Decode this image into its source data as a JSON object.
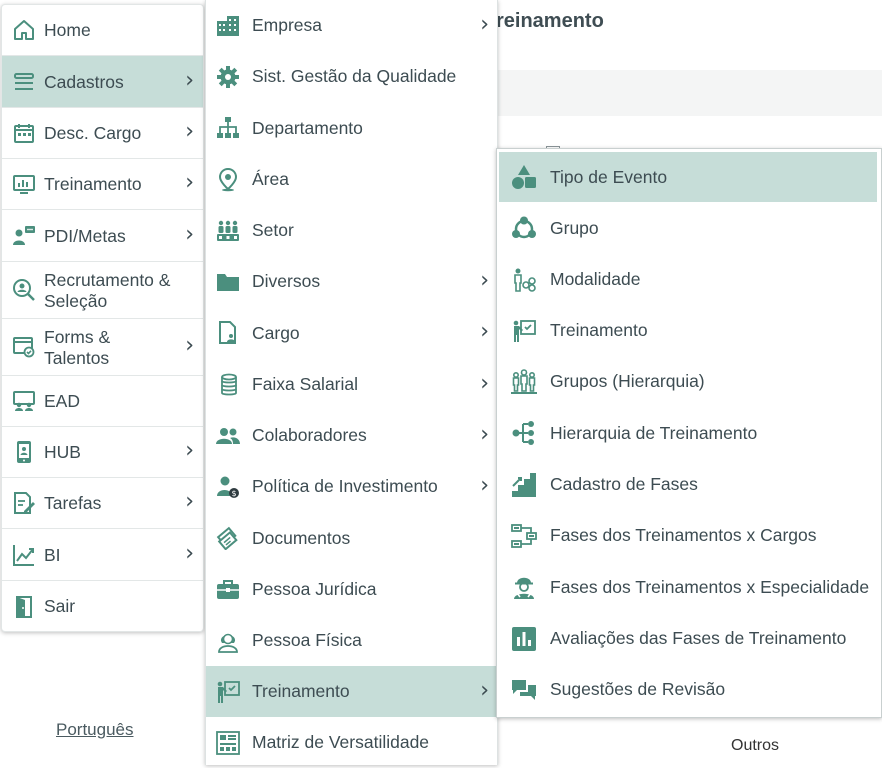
{
  "background": {
    "title": "reinamento",
    "language_link": "Português",
    "other_label": "Outros"
  },
  "colors": {
    "accent": "#4b8f7e",
    "active_bg": "#c6ddd8",
    "text": "#3d4c52"
  },
  "main_menu": {
    "items": [
      {
        "label": "Home",
        "icon": "home-icon",
        "has_submenu": false
      },
      {
        "label": "Cadastros",
        "icon": "list-icon",
        "has_submenu": true,
        "active": true
      },
      {
        "label": "Desc. Cargo",
        "icon": "calendar-icon",
        "has_submenu": true
      },
      {
        "label": "Treinamento",
        "icon": "presentation-icon",
        "has_submenu": true
      },
      {
        "label": "PDI/Metas",
        "icon": "user-chat-icon",
        "has_submenu": true
      },
      {
        "label": "Recrutamento & Seleção",
        "icon": "user-search-icon",
        "has_submenu": false
      },
      {
        "label": "Forms & Talentos",
        "icon": "form-check-icon",
        "has_submenu": true
      },
      {
        "label": "EAD",
        "icon": "classroom-icon",
        "has_submenu": false
      },
      {
        "label": "HUB",
        "icon": "phone-icon",
        "has_submenu": true
      },
      {
        "label": "Tarefas",
        "icon": "edit-document-icon",
        "has_submenu": true
      },
      {
        "label": "BI",
        "icon": "line-chart-icon",
        "has_submenu": true
      },
      {
        "label": "Sair",
        "icon": "exit-door-icon",
        "has_submenu": false
      }
    ]
  },
  "cadastros_menu": {
    "items": [
      {
        "label": "Empresa",
        "icon": "building-icon",
        "has_submenu": true
      },
      {
        "label": "Sist. Gestão da Qualidade",
        "icon": "gear-icon",
        "has_submenu": false
      },
      {
        "label": "Departamento",
        "icon": "org-chart-icon",
        "has_submenu": false
      },
      {
        "label": "Área",
        "icon": "map-pin-icon",
        "has_submenu": false
      },
      {
        "label": "Setor",
        "icon": "group-icon",
        "has_submenu": false
      },
      {
        "label": "Diversos",
        "icon": "folder-icon",
        "has_submenu": true
      },
      {
        "label": "Cargo",
        "icon": "document-user-icon",
        "has_submenu": true
      },
      {
        "label": "Faixa Salarial",
        "icon": "coins-icon",
        "has_submenu": true
      },
      {
        "label": "Colaboradores",
        "icon": "users-icon",
        "has_submenu": true
      },
      {
        "label": "Política de Investimento",
        "icon": "user-money-icon",
        "has_submenu": true
      },
      {
        "label": "Documentos",
        "icon": "documents-icon",
        "has_submenu": false
      },
      {
        "label": "Pessoa Jurídica",
        "icon": "briefcase-icon",
        "has_submenu": false
      },
      {
        "label": "Pessoa Física",
        "icon": "person-icon",
        "has_submenu": false
      },
      {
        "label": "Treinamento",
        "icon": "presentation-icon",
        "has_submenu": true,
        "active": true
      },
      {
        "label": "Matriz de Versatilidade",
        "icon": "matrix-icon",
        "has_submenu": false
      }
    ]
  },
  "treinamento_menu": {
    "items": [
      {
        "label": "Tipo de Evento",
        "icon": "shapes-icon",
        "active": true
      },
      {
        "label": "Grupo",
        "icon": "group-circle-icon"
      },
      {
        "label": "Modalidade",
        "icon": "modality-icon"
      },
      {
        "label": "Treinamento",
        "icon": "presentation-icon"
      },
      {
        "label": "Grupos (Hierarquia)",
        "icon": "people-hierarchy-icon"
      },
      {
        "label": "Hierarquia de Treinamento",
        "icon": "tree-icon"
      },
      {
        "label": "Cadastro de Fases",
        "icon": "stairs-icon"
      },
      {
        "label": "Fases dos Treinamentos x Cargos",
        "icon": "flow-icon"
      },
      {
        "label": "Fases dos Treinamentos x Especialidade",
        "icon": "worker-icon"
      },
      {
        "label": "Avaliações das Fases de Treinamento",
        "icon": "bar-chart-icon"
      },
      {
        "label": "Sugestões de Revisão",
        "icon": "chat-icon"
      }
    ]
  }
}
